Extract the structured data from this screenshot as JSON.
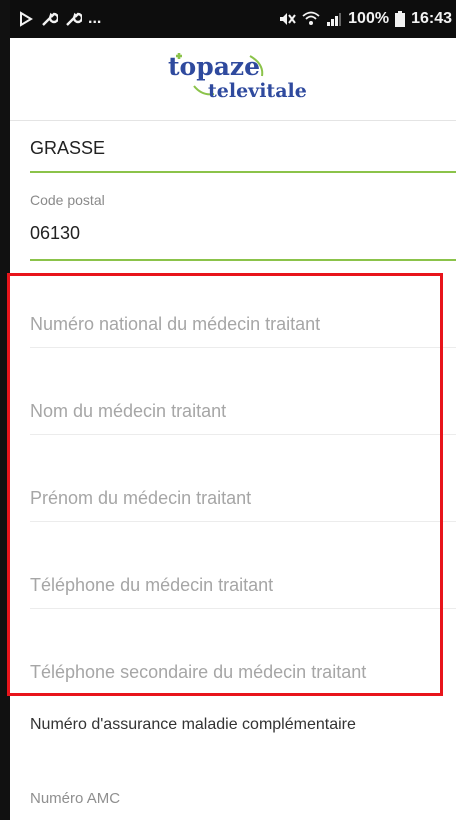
{
  "status_bar": {
    "left_overflow": "...",
    "battery": "100%",
    "time": "16:43"
  },
  "logo": {
    "line1": "topaze",
    "line2": "televitale"
  },
  "form": {
    "city_value": "GRASSE",
    "postal_code_label": "Code postal",
    "postal_code_value": "06130",
    "doctor_national_number_placeholder": "Numéro national du médecin traitant",
    "doctor_last_name_placeholder": "Nom du médecin traitant",
    "doctor_first_name_placeholder": "Prénom du médecin traitant",
    "doctor_phone_placeholder": "Téléphone du médecin traitant",
    "doctor_secondary_phone_placeholder": "Téléphone secondaire du médecin traitant",
    "complementary_insurance_label": "Numéro d'assurance maladie complémentaire",
    "amc_number_label": "Numéro AMC"
  },
  "colors": {
    "accent_green": "#8bc34a",
    "highlight_red": "#e8141b",
    "logo_blue": "#2f4a9e"
  }
}
